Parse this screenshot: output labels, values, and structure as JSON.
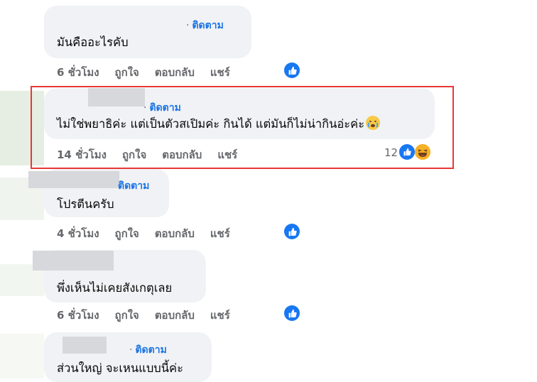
{
  "comments": [
    {
      "follow_label": "ติดตาม",
      "text": "มันคืออะไรคับ",
      "time": "6 ชั่วโมง",
      "like": "ถูกใจ",
      "reply": "ตอบกลับ",
      "share": "แชร์"
    },
    {
      "follow_label": "ติดตาม",
      "text": "ไม่ใช่พยาธิค่ะ แต่เป็นตัวสเปิมค่ะ กินได้ แต่มันก็ไม่น่ากินอ่ะค่ะ",
      "time": "14 ชั่วโมง",
      "like": "ถูกใจ",
      "reply": "ตอบกลับ",
      "share": "แชร์",
      "reaction_count": "12"
    },
    {
      "follow_label": "ติดตาม",
      "text": "โปรตีนครับ",
      "time": "4 ชั่วโมง",
      "like": "ถูกใจ",
      "reply": "ตอบกลับ",
      "share": "แชร์"
    },
    {
      "text": "พึ่งเห็นไม่เคยสังเกตุเลย",
      "time": "6 ชั่วโมง",
      "like": "ถูกใจ",
      "reply": "ตอบกลับ",
      "share": "แชร์"
    },
    {
      "follow_label": "ติดตาม",
      "text": "ส่วนใหญ่ จะเหนแบบนี้ค่ะ"
    }
  ],
  "colors": {
    "accent": "#1877f2",
    "highlight_border": "#e53935"
  }
}
